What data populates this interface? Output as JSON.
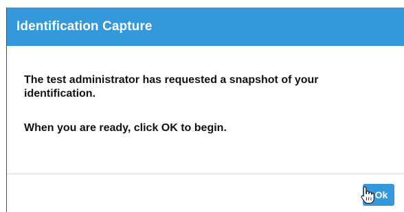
{
  "dialog": {
    "title": "Identification Capture",
    "messages": [
      "The test administrator has requested a snapshot of your identification.",
      "When you are ready, click OK to begin."
    ],
    "ok_label": "Ok"
  },
  "colors": {
    "header_bg": "#3498db",
    "button_bg": "#3498db",
    "text": "#111111"
  },
  "icons": {
    "cursor": "hand-pointer-icon"
  }
}
